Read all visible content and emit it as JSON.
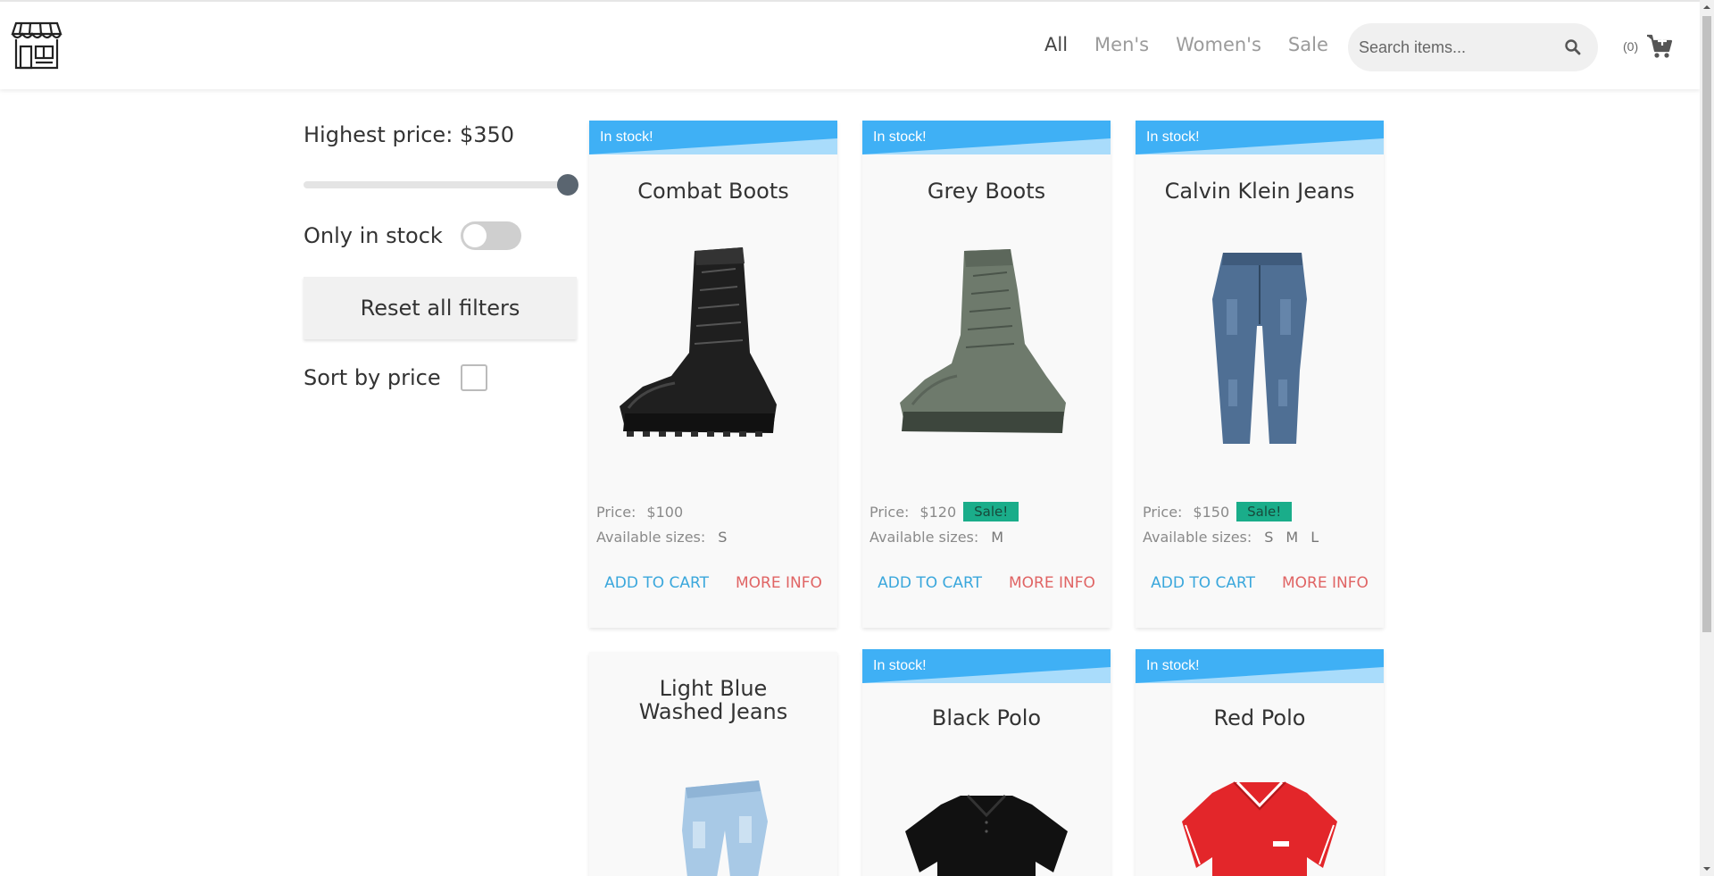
{
  "header": {
    "nav": [
      "All",
      "Men's",
      "Women's",
      "Sale"
    ],
    "active_nav": "All",
    "search_placeholder": "Search items...",
    "cart_count": "(0)"
  },
  "filters": {
    "price_label": "Highest price:",
    "price_value": "$350",
    "price_fraction": 1.0,
    "stock_label": "Only in stock",
    "stock_on": false,
    "reset_label": "Reset all filters",
    "sort_label": "Sort by price",
    "sort_checked": false
  },
  "products": [
    {
      "title": "Combat Boots",
      "ribbon": "In stock!",
      "price_label": "Price:",
      "price": "$100",
      "sale": "",
      "sizes_label": "Available sizes:",
      "sizes": [
        "S"
      ],
      "add": "ADD TO CART",
      "more": "MORE INFO",
      "image": "black-combat-boot"
    },
    {
      "title": "Grey Boots",
      "ribbon": "In stock!",
      "price_label": "Price:",
      "price": "$120",
      "sale": "Sale!",
      "sizes_label": "Available sizes:",
      "sizes": [
        "M"
      ],
      "add": "ADD TO CART",
      "more": "MORE INFO",
      "image": "grey-boot"
    },
    {
      "title": "Calvin Klein Jeans",
      "ribbon": "In stock!",
      "price_label": "Price:",
      "price": "$150",
      "sale": "Sale!",
      "sizes_label": "Available sizes:",
      "sizes": [
        "S",
        "M",
        "L"
      ],
      "add": "ADD TO CART",
      "more": "MORE INFO",
      "image": "dark-blue-jeans"
    },
    {
      "title": "Light Blue Washed Jeans",
      "ribbon": "",
      "image": "light-blue-jeans"
    },
    {
      "title": "Black Polo",
      "ribbon": "In stock!",
      "image": "black-polo"
    },
    {
      "title": "Red Polo",
      "ribbon": "In stock!",
      "image": "red-polo"
    }
  ],
  "colors": {
    "ribbon": "#3fb0f5",
    "ribbon_light": "#a9dcfb",
    "sale": "#1aad8a",
    "add_to_cart": "#3aa7dc",
    "more_info": "#e06464"
  }
}
